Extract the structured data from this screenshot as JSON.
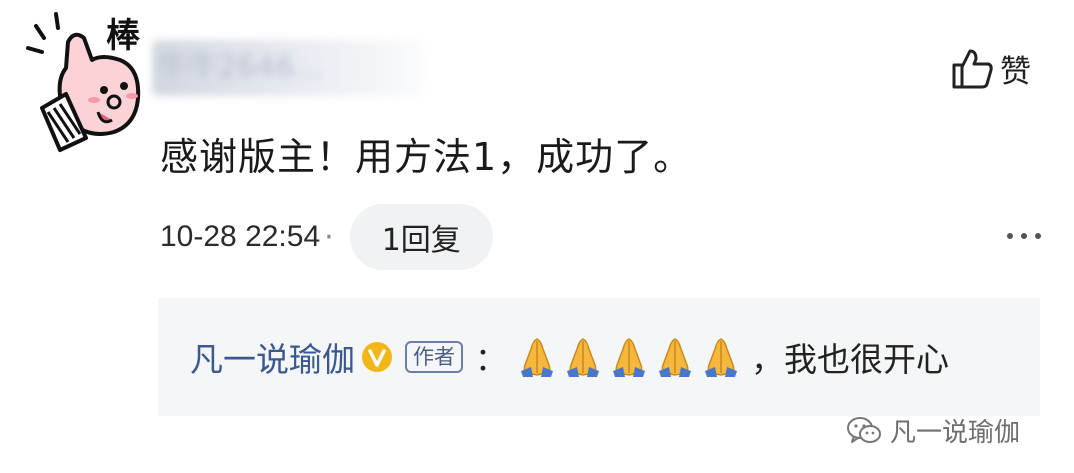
{
  "comment": {
    "username_blurred": "牛牛2646...",
    "like_label": "赞",
    "text": "感谢版主！用方法1，成功了。",
    "timestamp": "10-28 22:54",
    "separator": "·",
    "reply_count_label": "1回复",
    "more_label": "..."
  },
  "avatar": {
    "badge_text": "棒",
    "icon": "thumbs-up-cartoon-icon"
  },
  "reply": {
    "author": "凡一说瑜伽",
    "verified_icon": "verified-v-icon",
    "author_tag": "作者",
    "colon": "：",
    "emoji_icon": "folded-hands-icon",
    "emoji_count": 5,
    "text": "，我也很开心"
  },
  "watermark": {
    "icon": "wechat-icon",
    "text": "凡一说瑜伽"
  },
  "colors": {
    "author_link": "#3a5a8f",
    "reply_bg": "#f5f6f7",
    "pill_bg": "#f1f2f4",
    "verified": "#f2b619"
  }
}
